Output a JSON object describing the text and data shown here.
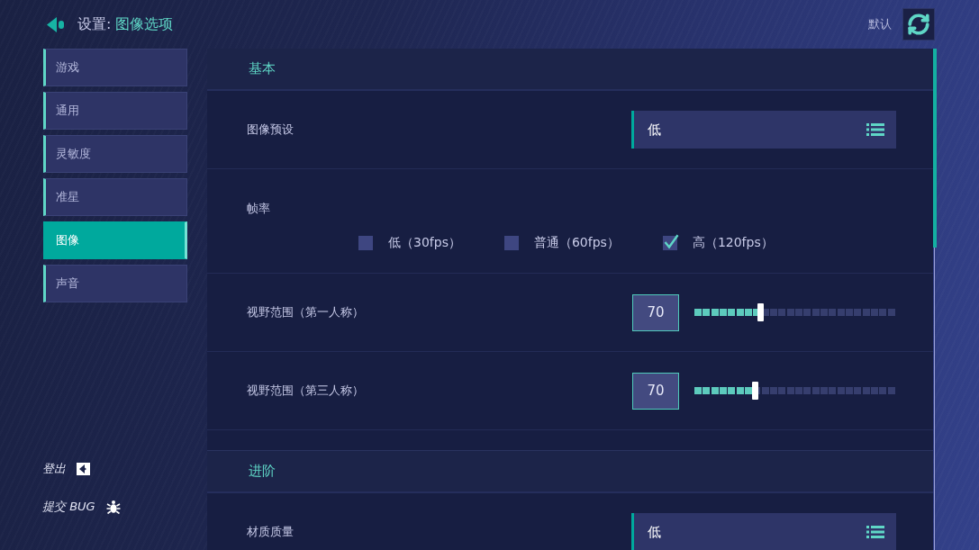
{
  "header": {
    "breadcrumb": "设置:",
    "title": "图像选项",
    "reset_label": "默认"
  },
  "sidebar": {
    "items": [
      {
        "label": "游戏",
        "selected": false
      },
      {
        "label": "通用",
        "selected": false
      },
      {
        "label": "灵敏度",
        "selected": false
      },
      {
        "label": "准星",
        "selected": false
      },
      {
        "label": "图像",
        "selected": true
      },
      {
        "label": "声音",
        "selected": false
      }
    ],
    "footer_links": [
      {
        "label": "登出",
        "kind": "logout"
      },
      {
        "label": "提交 BUG",
        "kind": "bug"
      }
    ]
  },
  "sections": [
    {
      "title": "基本",
      "rows": [
        {
          "kind": "dropdown",
          "label": "图像预设",
          "value": "低"
        },
        {
          "kind": "checkboxes",
          "label": "帧率",
          "options": [
            {
              "label": "低（30fps）",
              "checked": false
            },
            {
              "label": "普通（60fps）",
              "checked": false
            },
            {
              "label": "高（120fps）",
              "checked": true
            }
          ]
        },
        {
          "kind": "slider",
          "label": "视野范围（第一人称）",
          "value": "70",
          "level": 0.33
        },
        {
          "kind": "slider",
          "label": "视野范围（第三人称）",
          "value": "70",
          "level": 0.3
        }
      ]
    },
    {
      "title": "进阶",
      "rows": [
        {
          "kind": "dropdown",
          "label": "材质质量",
          "value": "低"
        }
      ]
    }
  ]
}
